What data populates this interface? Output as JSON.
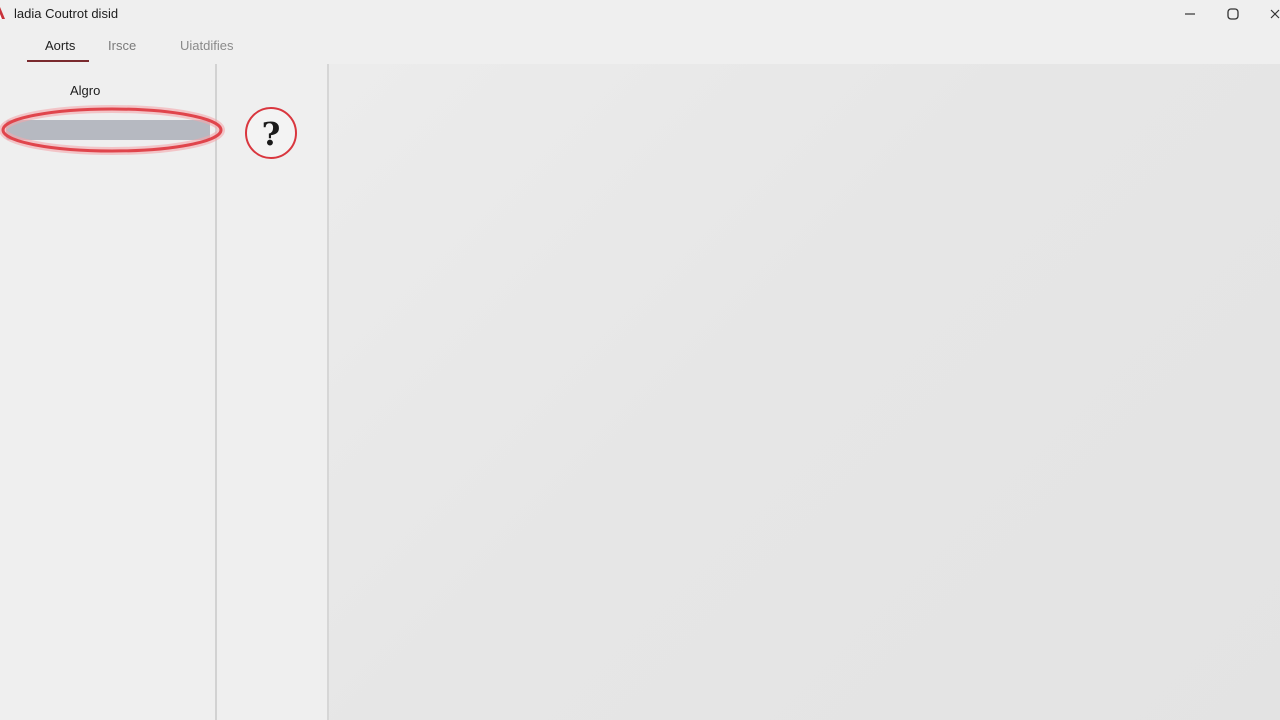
{
  "window": {
    "title": "ladia Coutrot disid",
    "controls": {
      "minimize": "minimize-icon",
      "maximize": "maximize-icon",
      "close": "close-icon"
    }
  },
  "tabs": [
    {
      "label": "Aorts",
      "active": true
    },
    {
      "label": "Irsce",
      "active": false
    },
    {
      "label": "Uiatdifies",
      "active": false
    }
  ],
  "sidebar": {
    "section_label": "Algro",
    "selected_item": ""
  },
  "help": {
    "glyph": "?",
    "icon": "question-mark-icon"
  },
  "colors": {
    "accent": "#d9363e",
    "tab_underline": "#7a2a2e",
    "selection": "#b6b9c1"
  }
}
